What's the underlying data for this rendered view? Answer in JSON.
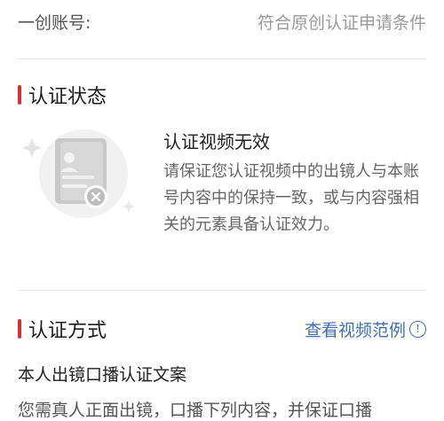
{
  "account_row": {
    "label": "一创账号:",
    "value": "符合原创认证申请条件"
  },
  "status_section": {
    "title": "认证状态",
    "status_title": "认证视频无效",
    "status_description": "请保证您认证视频中的出镜人与本账号内容中的保持一致，或与内容强相关的元素具备认证效力。",
    "icon": "document-rejected-icon"
  },
  "method_section": {
    "title": "认证方式",
    "example_link": "查看视频范例",
    "info_icon": "info-circle-icon",
    "subtitle": "本人出镜口播认证文案",
    "body_text": "您需真人正面出镜，口播下列内容，并保证口播"
  },
  "colors": {
    "accent": "#d9302c",
    "link": "#3f6fb5"
  }
}
